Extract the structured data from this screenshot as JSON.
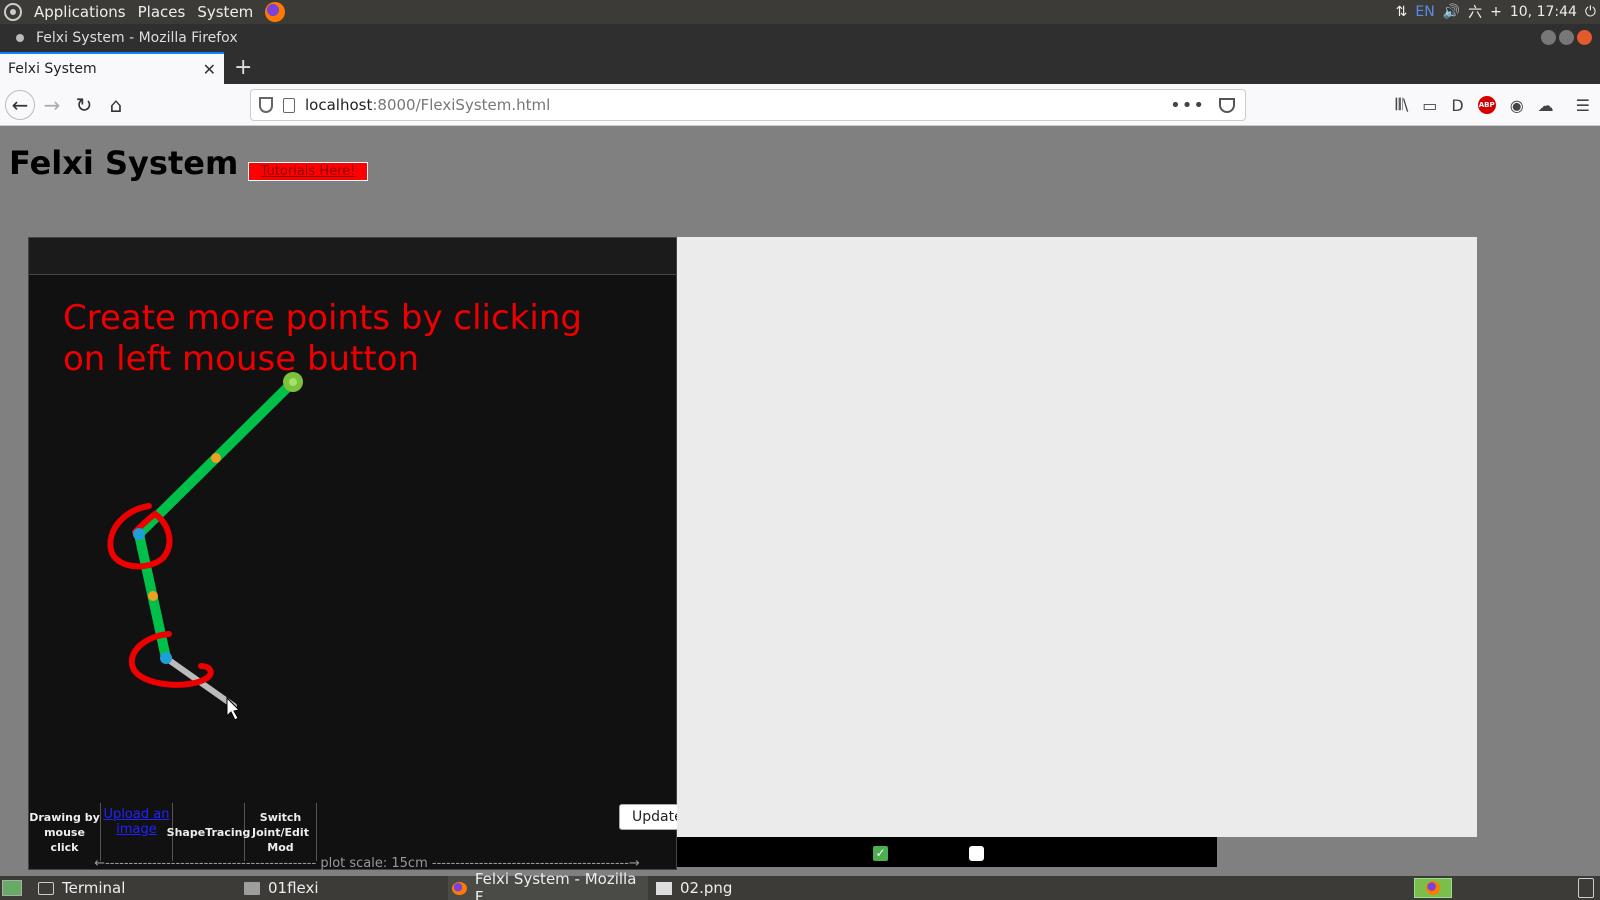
{
  "system_panel": {
    "menus": [
      "Applications",
      "Places",
      "System"
    ],
    "tray": {
      "keyboard": "EN",
      "datetime": "10, 17:44"
    }
  },
  "window": {
    "title": "Felxi System - Mozilla Firefox"
  },
  "browser": {
    "tab_title": "Felxi System",
    "url_host": "localhost",
    "url_path": ":8000/FlexiSystem.html"
  },
  "page": {
    "title": "Felxi System",
    "tutorial_button": "Tutorials Here!",
    "hint": "Create more points by clicking on left mouse button",
    "tools": {
      "draw": "Drawing by mouse click",
      "upload": "Upload an image",
      "shape": "ShapeTracing",
      "switch": "Switch Joint/Edit Mod"
    },
    "update_button": "Update",
    "plot_scale": "plot scale: 15cm"
  },
  "colors": {
    "link_green": "#00c04a",
    "annotation_red": "#ee0000",
    "joint_blue": "#1e9fd8",
    "midpoint_orange": "#f0a020"
  },
  "taskbar": {
    "items": [
      "Terminal",
      "01flexi",
      "Felxi System - Mozilla F...",
      "02.png"
    ]
  }
}
